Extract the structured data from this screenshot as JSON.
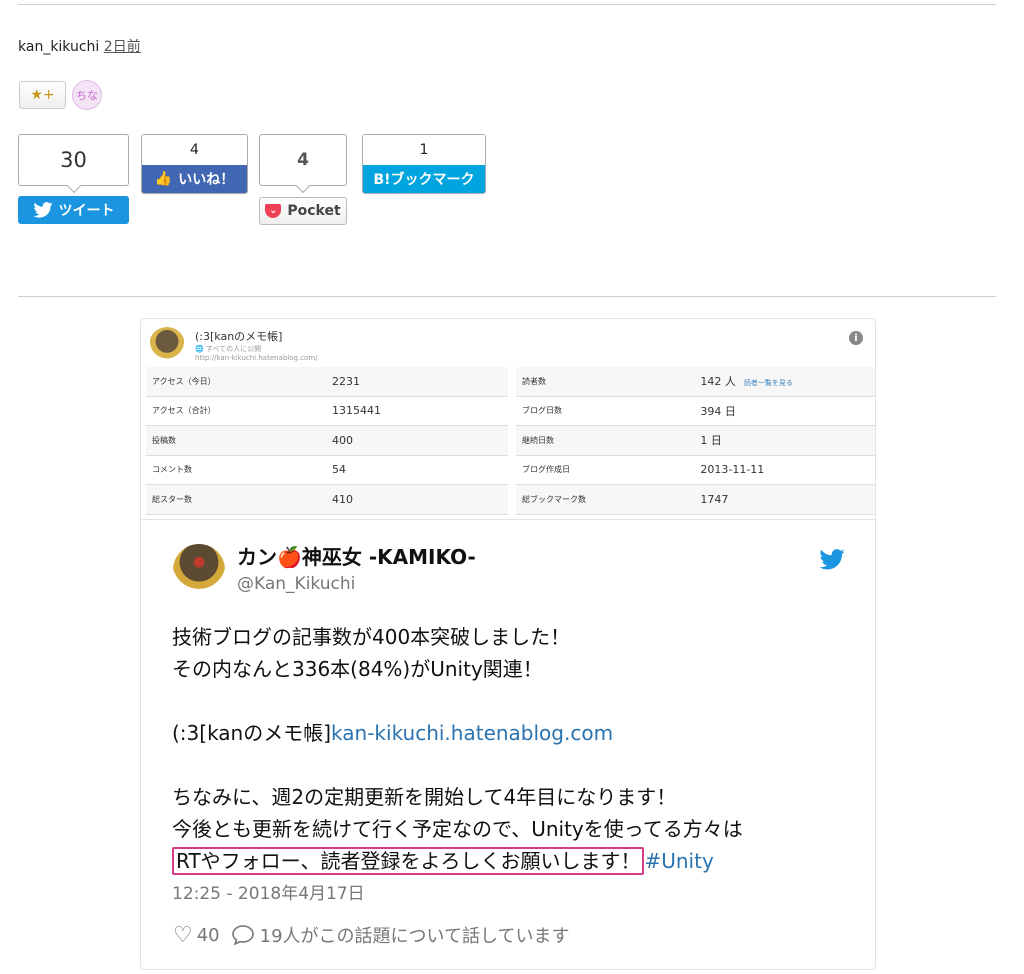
{
  "post": {
    "author": "kan_kikuchi",
    "time": "2日前"
  },
  "stars": {
    "add_label": "★+",
    "user_label": "ちな"
  },
  "share": {
    "twitter": {
      "count": "30",
      "label": "ツイート"
    },
    "facebook": {
      "count": "4",
      "label": "いいね！"
    },
    "pocket": {
      "count": "4",
      "label": "Pocket"
    },
    "hatena": {
      "count": "1",
      "label": "B!ブックマーク"
    }
  },
  "stats": {
    "blog_title": "(:3[kanのメモ帳]",
    "visibility": "すべての人に公開",
    "url": "http://kan-kikuchi.hatenablog.com/",
    "left": [
      {
        "label": "アクセス（今日）",
        "value": "2231"
      },
      {
        "label": "アクセス（合計）",
        "value": "1315441"
      },
      {
        "label": "投稿数",
        "value": "400"
      },
      {
        "label": "コメント数",
        "value": "54"
      },
      {
        "label": "総スター数",
        "value": "410"
      }
    ],
    "right": [
      {
        "label": "読者数",
        "value": "142 人",
        "link": "読者一覧を見る"
      },
      {
        "label": "ブログ日数",
        "value": "394 日"
      },
      {
        "label": "継続日数",
        "value": "1 日"
      },
      {
        "label": "ブログ作成日",
        "value": "2013-11-11"
      },
      {
        "label": "総ブックマーク数",
        "value": "1747"
      }
    ]
  },
  "tweet": {
    "name": "カン🍎神巫女 -KAMIKO-",
    "handle": "@Kan_Kikuchi",
    "line1": "技術ブログの記事数が400本突破しました！",
    "line2": "その内なんと336本(84%)がUnity関連！",
    "blog_name": "(:3[kanのメモ帳]",
    "blog_link": "kan-kikuchi.hatenablog.com",
    "line3": "ちなみに、週2の定期更新を開始して4年目になります！",
    "line4": "今後とも更新を続けて行く予定なので、Unityを使ってる方々は",
    "line5": "RTやフォロー、読者登録をよろしくお願いします！",
    "hashtag": "#Unity",
    "timestamp": "12:25 - 2018年4月17日",
    "likes": "40",
    "talk": "19人がこの話題について話しています"
  },
  "colors": {
    "twitter": "#1b95e0",
    "facebook": "#4267b2",
    "hatena": "#00a4de",
    "pocket": "#ef4056",
    "highlight": "#d53d87"
  }
}
